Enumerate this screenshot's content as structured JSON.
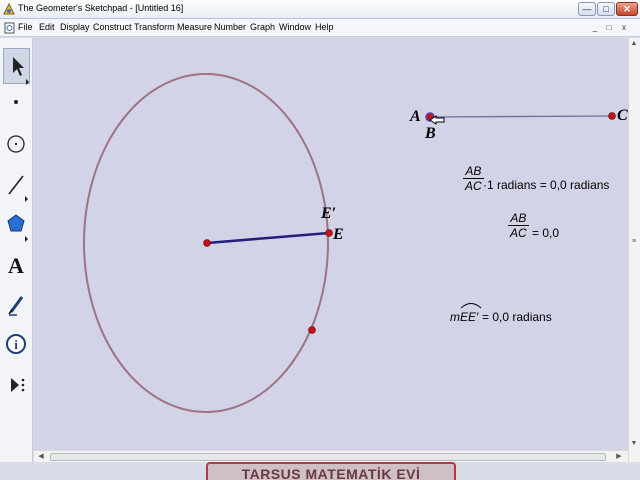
{
  "window": {
    "title": "The Geometer's Sketchpad - [Untitled 16]",
    "min_glyph": "—",
    "max_glyph": "□",
    "close_glyph": "✕"
  },
  "menu": {
    "items": [
      "File",
      "Edit",
      "Display",
      "Construct",
      "Transform",
      "Measure",
      "Number",
      "Graph",
      "Window",
      "Help"
    ],
    "doc_min_glyph": "_",
    "doc_max_glyph": "□",
    "doc_close_glyph": "x"
  },
  "toolbox": {
    "tools": [
      "arrow-tool",
      "point-tool",
      "compass-tool",
      "straightedge-tool",
      "polygon-tool",
      "text-tool",
      "marker-tool",
      "information-tool",
      "custom-tool"
    ],
    "selected": "arrow-tool",
    "text_tool_glyph": "A",
    "info_tool_glyph": "i"
  },
  "sketch": {
    "labels": {
      "A": "A",
      "B": "B",
      "C": "C",
      "E": "E",
      "E_prime": "E′"
    },
    "measurements": {
      "ratio_radians": {
        "numerator": "AB",
        "denominator": "AC",
        "suffix": "·1 radians = 0,0 radians"
      },
      "ratio": {
        "numerator": "AB",
        "denominator": "AC",
        "suffix": "= 0,0"
      },
      "arc": {
        "prefix": "m",
        "arc_name": "EE′",
        "suffix": "= 0,0 radians"
      }
    },
    "colors": {
      "canvas": "#d2d3e6",
      "circle": "#9e7382",
      "radius_segment": "#25207a",
      "point": "#c4111b",
      "line_AC": "#6c6f9c"
    }
  },
  "watermark": "TARSUS MATEMATİK EVİ"
}
